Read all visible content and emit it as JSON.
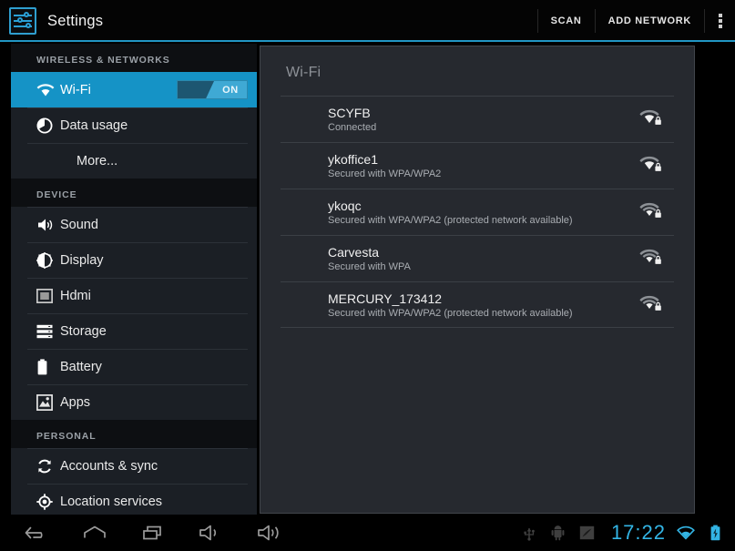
{
  "action_bar": {
    "app_icon": "settings-sliders-icon",
    "title": "Settings",
    "scan_label": "SCAN",
    "add_network_label": "ADD NETWORK",
    "overflow_label": "overflow-menu",
    "accent_color": "#2196c4"
  },
  "sidebar": {
    "sections": [
      {
        "header": "WIRELESS & NETWORKS",
        "items": [
          {
            "label": "Wi-Fi",
            "icon": "wifi-icon",
            "selected": true,
            "toggle": {
              "state": "ON",
              "on": true
            }
          },
          {
            "label": "Data usage",
            "icon": "data-usage-icon",
            "selected": false
          },
          {
            "label": "More...",
            "icon": "none",
            "selected": false
          }
        ]
      },
      {
        "header": "DEVICE",
        "items": [
          {
            "label": "Sound",
            "icon": "sound-speaker-icon",
            "selected": false
          },
          {
            "label": "Display",
            "icon": "display-brightness-icon",
            "selected": false
          },
          {
            "label": "Hdmi",
            "icon": "hdmi-screen-icon",
            "selected": false
          },
          {
            "label": "Storage",
            "icon": "storage-stack-icon",
            "selected": false
          },
          {
            "label": "Battery",
            "icon": "battery-icon",
            "selected": false
          },
          {
            "label": "Apps",
            "icon": "apps-image-icon",
            "selected": false
          }
        ]
      },
      {
        "header": "PERSONAL",
        "items": [
          {
            "label": "Accounts & sync",
            "icon": "sync-arrows-icon",
            "selected": false
          },
          {
            "label": "Location services",
            "icon": "location-crosshair-icon",
            "selected": false
          }
        ]
      }
    ]
  },
  "panel": {
    "title": "Wi-Fi",
    "networks": [
      {
        "name": "SCYFB",
        "status": "Connected",
        "icon": "wifi-signal-lock-icon",
        "bars": 3
      },
      {
        "name": "ykoffice1",
        "status": "Secured with WPA/WPA2",
        "icon": "wifi-signal-lock-icon",
        "bars": 3
      },
      {
        "name": "ykoqc",
        "status": "Secured with WPA/WPA2 (protected network available)",
        "icon": "wifi-signal-lock-icon",
        "bars": 2
      },
      {
        "name": "Carvesta",
        "status": "Secured with WPA",
        "icon": "wifi-signal-lock-icon",
        "bars": 2
      },
      {
        "name": "MERCURY_173412",
        "status": "Secured with WPA/WPA2 (protected network available)",
        "icon": "wifi-signal-lock-icon",
        "bars": 2
      }
    ]
  },
  "navbar": {
    "buttons": [
      {
        "name": "back-icon",
        "label": "Back"
      },
      {
        "name": "home-icon",
        "label": "Home"
      },
      {
        "name": "recents-icon",
        "label": "Recent apps"
      },
      {
        "name": "volume-down-icon",
        "label": "Volume down"
      },
      {
        "name": "volume-up-icon",
        "label": "Volume up"
      }
    ],
    "status_icons": [
      {
        "name": "usb-icon"
      },
      {
        "name": "android-debug-icon"
      },
      {
        "name": "screenshot-icon"
      }
    ],
    "clock": "17:22",
    "wifi_icon": "wifi-status-icon",
    "battery_icon": "battery-charging-icon",
    "status_accent_color": "#33b5e5"
  }
}
